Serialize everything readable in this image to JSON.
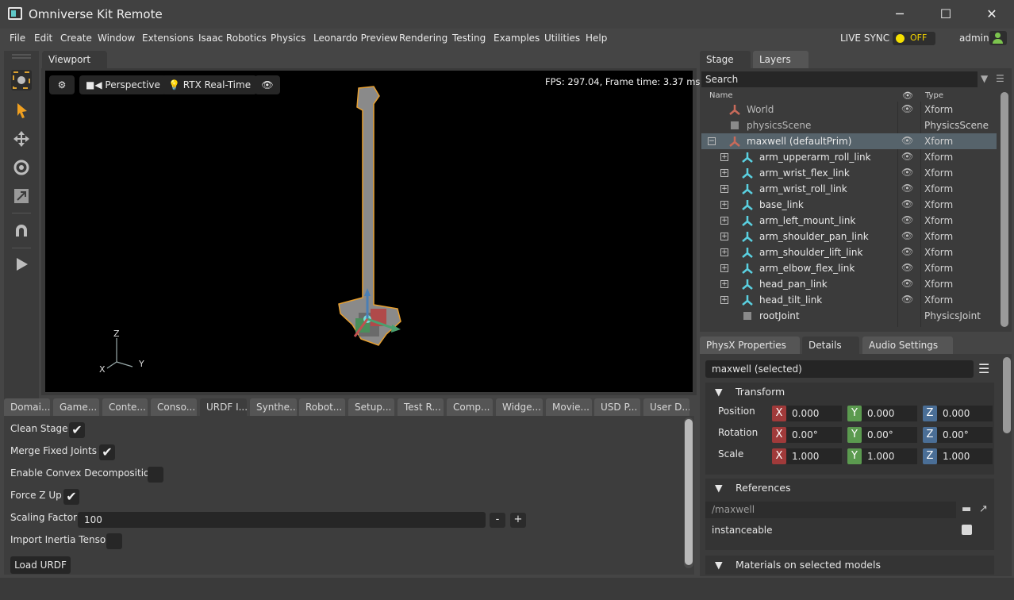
{
  "window": {
    "title": "Omniverse Kit Remote",
    "minimize": "─",
    "maximize": "☐",
    "close": "✕"
  },
  "menu": [
    "File",
    "Edit",
    "Create",
    "Window",
    "Extensions",
    "Isaac Robotics",
    "Physics",
    "Leonardo Preview",
    "Rendering",
    "Testing",
    "Examples",
    "Utilities",
    "Help"
  ],
  "live_sync": {
    "label": "LIVE SYNC",
    "state": "OFF",
    "indicator_color": "#f5e000"
  },
  "user": {
    "name": "admin"
  },
  "toolbar": {
    "icons": [
      "camera-focus-icon",
      "select-arrow-icon",
      "move-icon",
      "rotate-icon",
      "scale-icon",
      "snap-magnet-icon",
      "play-icon"
    ]
  },
  "viewport": {
    "tab": "Viewport",
    "camera": "Perspective",
    "renderer": "RTX Real-Time",
    "fps": "FPS: 297.04, Frame time: 3.37 ms",
    "axes": {
      "z": "Z",
      "x": "X",
      "y": "Y"
    }
  },
  "bottom_tabs": [
    "Domai...",
    "Game...",
    "Conte...",
    "Conso...",
    "URDF I...",
    "Synthe...",
    "Robot...",
    "Setup...",
    "Test R...",
    "Comp...",
    "Widge...",
    "Movie...",
    "USD P...",
    "User D..."
  ],
  "urdf_importer": {
    "clean_stage": {
      "label": "Clean Stage",
      "checked": true
    },
    "merge_fixed_joints": {
      "label": "Merge Fixed Joints",
      "checked": true
    },
    "convex_decomposition": {
      "label": "Enable Convex Decomposition",
      "checked": false
    },
    "force_z_up": {
      "label": "Force Z Up",
      "checked": true
    },
    "scaling_factor": {
      "label": "Scaling Factor",
      "value": "100",
      "minus": "-",
      "plus": "+"
    },
    "import_inertia": {
      "label": "Import Inertia Tensor",
      "checked": false
    },
    "load_button": "Load URDF"
  },
  "stage": {
    "tabs": [
      "Stage",
      "Layers"
    ],
    "search_placeholder": "Search",
    "columns": {
      "name": "Name",
      "type": "Type"
    },
    "rows": [
      {
        "name": "World",
        "type": "Xform",
        "indent": 0,
        "icon": "xform-icon",
        "eye": true,
        "expand": ""
      },
      {
        "name": "physicsScene",
        "type": "PhysicsScene",
        "indent": 0,
        "icon": "cube-icon",
        "eye": false,
        "expand": ""
      },
      {
        "name": "maxwell (defaultPrim)",
        "type": "Xform",
        "indent": 0,
        "icon": "xform-icon",
        "eye": true,
        "expand": "−",
        "selected": true
      },
      {
        "name": "arm_upperarm_roll_link",
        "type": "Xform",
        "indent": 1,
        "icon": "xform-icon",
        "eye": true,
        "expand": "+"
      },
      {
        "name": "arm_wrist_flex_link",
        "type": "Xform",
        "indent": 1,
        "icon": "xform-icon",
        "eye": true,
        "expand": "+"
      },
      {
        "name": "arm_wrist_roll_link",
        "type": "Xform",
        "indent": 1,
        "icon": "xform-icon",
        "eye": true,
        "expand": "+"
      },
      {
        "name": "base_link",
        "type": "Xform",
        "indent": 1,
        "icon": "xform-icon",
        "eye": true,
        "expand": "+"
      },
      {
        "name": "arm_left_mount_link",
        "type": "Xform",
        "indent": 1,
        "icon": "xform-icon",
        "eye": true,
        "expand": "+"
      },
      {
        "name": "arm_shoulder_pan_link",
        "type": "Xform",
        "indent": 1,
        "icon": "xform-icon",
        "eye": true,
        "expand": "+"
      },
      {
        "name": "arm_shoulder_lift_link",
        "type": "Xform",
        "indent": 1,
        "icon": "xform-icon",
        "eye": true,
        "expand": "+"
      },
      {
        "name": "arm_elbow_flex_link",
        "type": "Xform",
        "indent": 1,
        "icon": "xform-icon",
        "eye": true,
        "expand": "+"
      },
      {
        "name": "head_pan_link",
        "type": "Xform",
        "indent": 1,
        "icon": "xform-icon",
        "eye": true,
        "expand": "+"
      },
      {
        "name": "head_tilt_link",
        "type": "Xform",
        "indent": 1,
        "icon": "xform-icon",
        "eye": true,
        "expand": "+"
      },
      {
        "name": "rootJoint",
        "type": "PhysicsJoint",
        "indent": 1,
        "icon": "cube-icon",
        "eye": false,
        "expand": ""
      }
    ]
  },
  "properties": {
    "tabs": [
      "PhysX Properties",
      "Details",
      "Audio Settings"
    ],
    "selected": "maxwell (selected)",
    "transform": {
      "title": "Transform",
      "position": {
        "label": "Position",
        "x": "0.000",
        "y": "0.000",
        "z": "0.000"
      },
      "rotation": {
        "label": "Rotation",
        "x": "0.00°",
        "y": "0.00°",
        "z": "0.00°"
      },
      "scale": {
        "label": "Scale",
        "x": "1.000",
        "y": "1.000",
        "z": "1.000"
      }
    },
    "references": {
      "title": "References",
      "path": "/maxwell",
      "instanceable": "instanceable"
    },
    "materials": {
      "title": "Materials on selected models"
    }
  }
}
